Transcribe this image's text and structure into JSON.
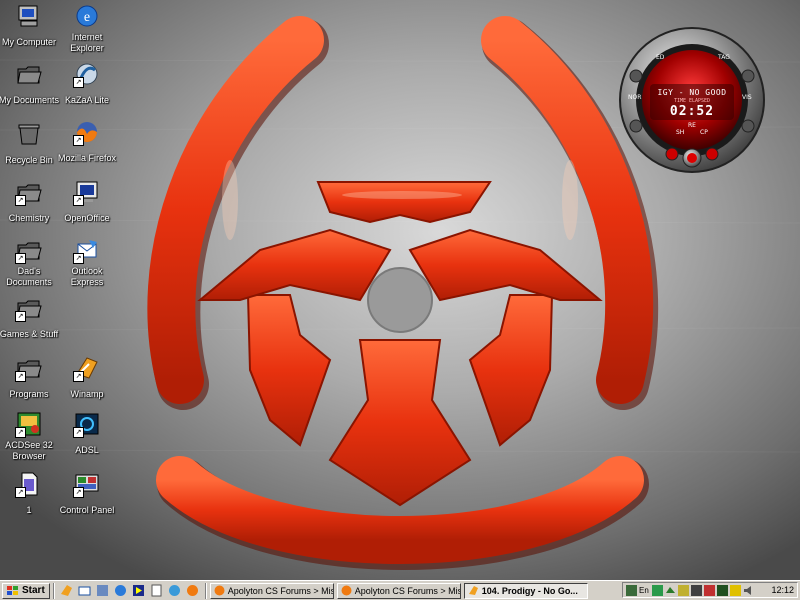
{
  "desktop": {
    "icons_left": [
      {
        "label": "My Computer",
        "icon": "my-computer-icon"
      },
      {
        "label": "My Documents",
        "icon": "folder-icon"
      },
      {
        "label": "Recycle Bin",
        "icon": "recycle-bin-icon"
      },
      {
        "label": "Chemistry",
        "icon": "folder-icon"
      },
      {
        "label": "Dad's Documents",
        "icon": "folder-icon"
      },
      {
        "label": "Games & Stuff",
        "icon": "folder-icon"
      },
      {
        "label": "Programs",
        "icon": "folder-icon"
      },
      {
        "label": "ACDSee 32 Browser",
        "icon": "acdsee-icon"
      },
      {
        "label": "1",
        "icon": "document-icon"
      }
    ],
    "icons_right": [
      {
        "label": "Internet Explorer",
        "icon": "internet-explorer-icon"
      },
      {
        "label": "KaZaA Lite",
        "icon": "kazaa-icon"
      },
      {
        "label": "Mozilla Firefox",
        "icon": "firefox-icon"
      },
      {
        "label": "OpenOffice",
        "icon": "openoffice-icon"
      },
      {
        "label": "Outlook Express",
        "icon": "outlook-express-icon"
      },
      {
        "label": "Winamp",
        "icon": "winamp-icon"
      },
      {
        "label": "ADSL",
        "icon": "adsl-icon"
      },
      {
        "label": "Control Panel",
        "icon": "control-panel-icon"
      }
    ]
  },
  "player": {
    "track": "IGY - NO GOOD",
    "status": "TIME ELAPSED",
    "time": "02:52",
    "label_ed": "ED",
    "label_tag": "TAG",
    "label_nor": "NOR",
    "label_vis": "VIS",
    "label_re": "RE",
    "label_sh": "SH",
    "label_cp": "CP"
  },
  "taskbar": {
    "start_label": "Start",
    "tasks": [
      {
        "label": "Apolyton CS Forums > Mis...",
        "active": false
      },
      {
        "label": "Apolyton CS Forums > Mis...",
        "active": false
      },
      {
        "label": "104. Prodigy - No Go...",
        "active": true
      }
    ],
    "tray_lang": "En",
    "clock": "12:12"
  },
  "colors": {
    "symbol_red": "#e8320f",
    "symbol_dark": "#8a1400",
    "taskbar_gray": "#d4d0c8",
    "selection_blue": "#0a246a"
  }
}
